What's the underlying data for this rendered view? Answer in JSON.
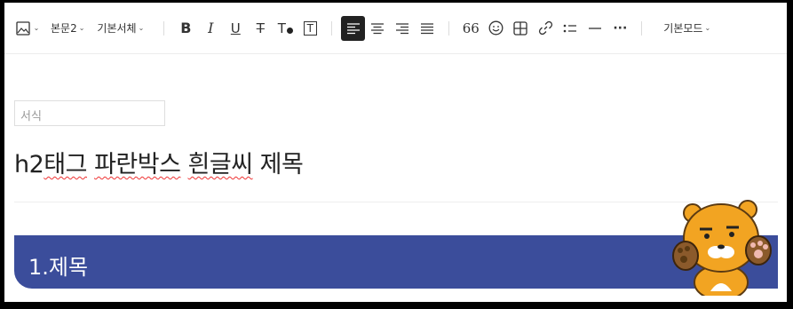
{
  "toolbar": {
    "image_icon": "image-icon",
    "paragraph_style": "본문2",
    "font_family": "기본서체",
    "bold": "B",
    "italic": "I",
    "underline": "U",
    "strikethrough": "T",
    "text_color": "T",
    "text_bg": "T",
    "quote": "66",
    "more": "···",
    "mode": "기본모드"
  },
  "content": {
    "format_placeholder": "서식",
    "heading_prefix": "h2",
    "heading_words": [
      "태그",
      "파란박스",
      "흰글씨",
      "제목"
    ],
    "blue_box_title": "1.제목"
  },
  "colors": {
    "blue_box": "#3b4d9b",
    "active_align": "#222222",
    "spellcheck": "#e33333"
  }
}
